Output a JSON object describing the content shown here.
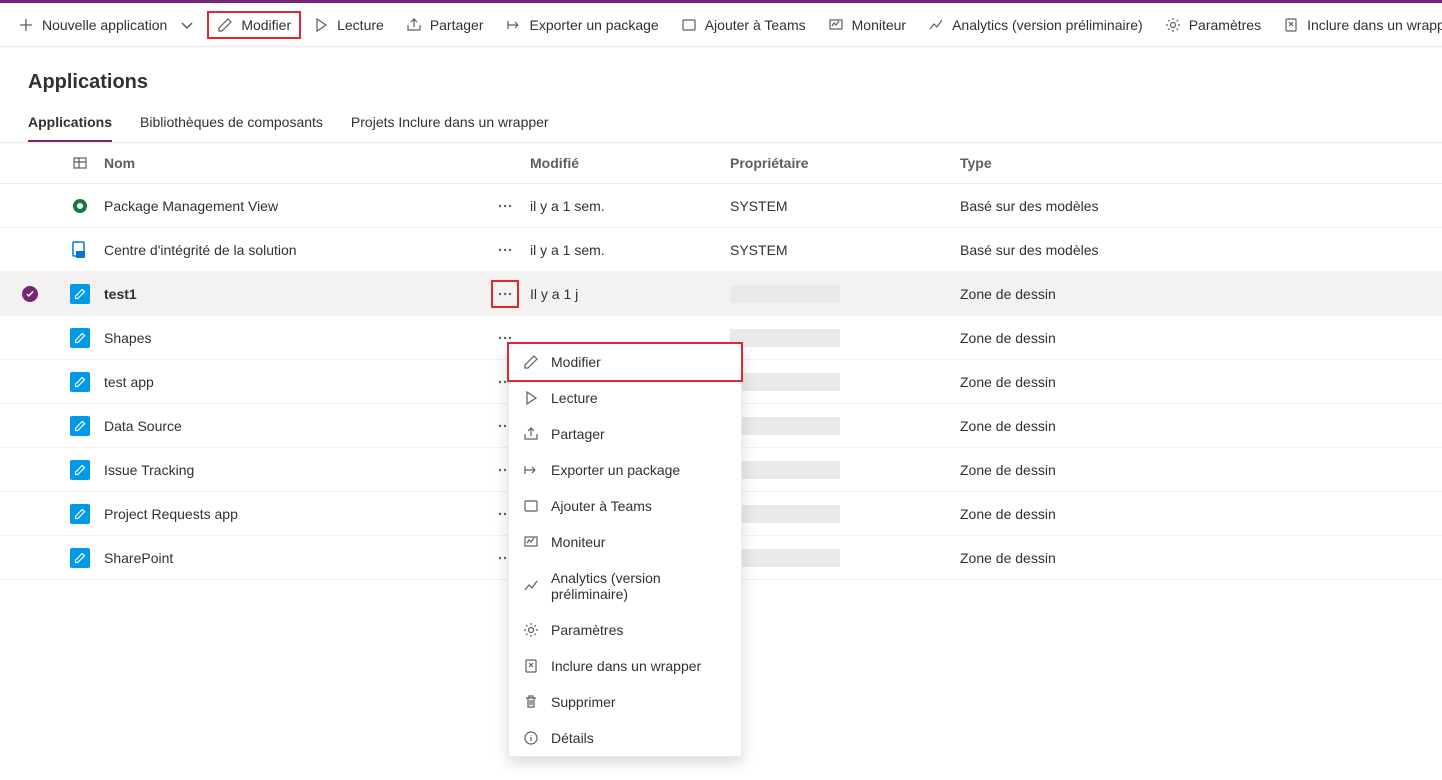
{
  "toolbar": {
    "new_app": "Nouvelle application",
    "edit": "Modifier",
    "play": "Lecture",
    "share": "Partager",
    "export": "Exporter un package",
    "teams": "Ajouter à Teams",
    "monitor": "Moniteur",
    "analytics": "Analytics (version préliminaire)",
    "settings": "Paramètres",
    "wrap": "Inclure dans un wrapper"
  },
  "page_title": "Applications",
  "tabs": {
    "apps": "Applications",
    "libraries": "Bibliothèques de composants",
    "wrap_projects": "Projets Inclure dans un wrapper"
  },
  "columns": {
    "name": "Nom",
    "modified": "Modifié",
    "owner": "Propriétaire",
    "type": "Type"
  },
  "type_model": "Basé sur des modèles",
  "type_canvas": "Zone de dessin",
  "rows": [
    {
      "name": "Package Management View",
      "modified": "il y a 1 sem.",
      "owner": "SYSTEM",
      "type_key": "type_model",
      "icon": "model1",
      "selected": false
    },
    {
      "name": "Centre d'intégrité de la solution",
      "modified": "il y a 1 sem.",
      "owner": "SYSTEM",
      "type_key": "type_model",
      "icon": "model2",
      "selected": false
    },
    {
      "name": "test1",
      "modified": "Il y a 1 j",
      "owner": "",
      "type_key": "type_canvas",
      "icon": "canvas",
      "selected": true
    },
    {
      "name": "Shapes",
      "modified": "",
      "owner": "",
      "type_key": "type_canvas",
      "icon": "canvas",
      "selected": false
    },
    {
      "name": "test app",
      "modified": "",
      "owner": "",
      "type_key": "type_canvas",
      "icon": "canvas",
      "selected": false
    },
    {
      "name": "Data Source",
      "modified": "",
      "owner": "",
      "type_key": "type_canvas",
      "icon": "canvas",
      "selected": false
    },
    {
      "name": "Issue Tracking",
      "modified": "",
      "owner": "",
      "type_key": "type_canvas",
      "icon": "canvas",
      "selected": false
    },
    {
      "name": "Project Requests app",
      "modified": "",
      "owner": "",
      "type_key": "type_canvas",
      "icon": "canvas",
      "selected": false
    },
    {
      "name": "SharePoint",
      "modified": "",
      "owner": "",
      "type_key": "type_canvas",
      "icon": "canvas",
      "selected": false
    }
  ],
  "context_menu": {
    "edit": "Modifier",
    "play": "Lecture",
    "share": "Partager",
    "export": "Exporter un package",
    "teams": "Ajouter à Teams",
    "monitor": "Moniteur",
    "analytics": "Analytics (version préliminaire)",
    "settings": "Paramètres",
    "wrap": "Inclure dans un wrapper",
    "delete": "Supprimer",
    "details": "Détails"
  }
}
